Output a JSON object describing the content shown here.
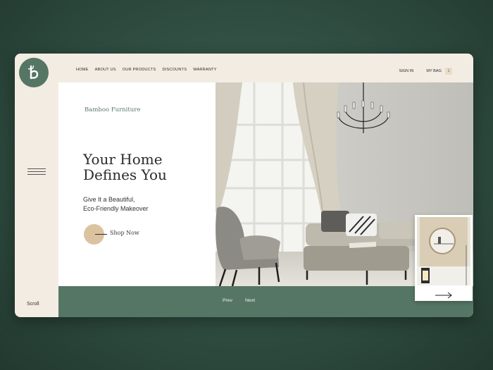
{
  "nav": {
    "items": [
      "HOME",
      "ABOUT US",
      "OUR PRODUCTS",
      "DISCOUNTS",
      "WARRANTY"
    ],
    "sign_in": "SIGN IN",
    "my_bag": "MY BAG",
    "bag_count": "1"
  },
  "hero": {
    "brand": "Bamboo Furniture",
    "headline_line1": "Your Home",
    "headline_line2": "Defines You",
    "sub_line1": "Give It a Beautiful,",
    "sub_line2": "Eco-Friendly Makeover",
    "cta": "Shop Now"
  },
  "sidebar": {
    "scroll_label": "Scroll"
  },
  "pager": {
    "prev": "Prev",
    "next": "Next"
  },
  "colors": {
    "green": "#557665",
    "cream": "#f3ece3",
    "tan": "#dcc3a0"
  },
  "icons": {
    "logo": "bamboo-logo-icon",
    "menu": "hamburger-menu-icon",
    "arrow": "arrow-right-icon"
  }
}
